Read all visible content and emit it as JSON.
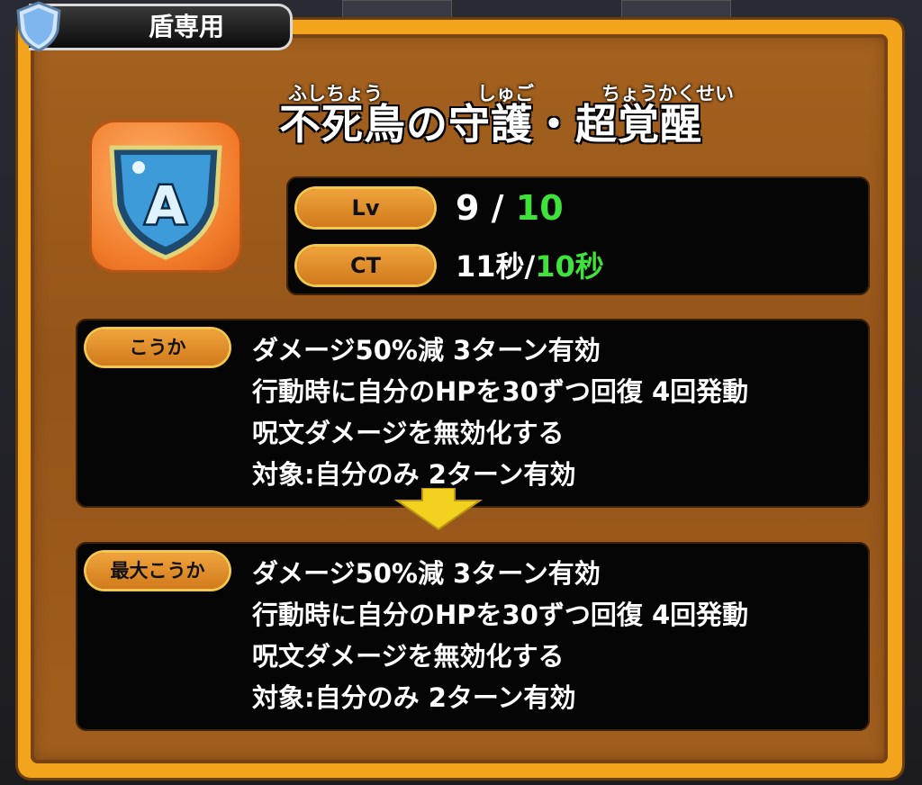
{
  "category_tab": {
    "label": "盾専用",
    "icon": "shield-icon"
  },
  "skill": {
    "icon": "rank-a-shield-icon",
    "rank": "A",
    "ruby": [
      "ふしちょう",
      "しゅご",
      "ちょうかくせい"
    ],
    "name": "不死鳥の守護・超覚醒"
  },
  "stats": {
    "level": {
      "label": "Lv",
      "current": "9 /",
      "max": "10"
    },
    "ct": {
      "label": "CT",
      "current": "11秒/",
      "max": "10秒"
    }
  },
  "effect": {
    "label": "こうか",
    "lines": [
      "ダメージ50%減 3ターン有効",
      "行動時に自分のHPを30ずつ回復 4回発動",
      "呪文ダメージを無効化する",
      "対象:自分のみ 2ターン有効"
    ]
  },
  "max_effect": {
    "label": "最大こうか",
    "lines": [
      "ダメージ50%減 3ターン有効",
      "行動時に自分のHPを30ずつ回復 4回発動",
      "呪文ダメージを無効化する",
      "対象:自分のみ 2ターン有効"
    ]
  },
  "colors": {
    "frame": "#f2a51c",
    "panel": "#a05e1e",
    "pill": "#e08c2a",
    "highlight_green": "#3fe23a",
    "arrow": "#f2d21e"
  }
}
